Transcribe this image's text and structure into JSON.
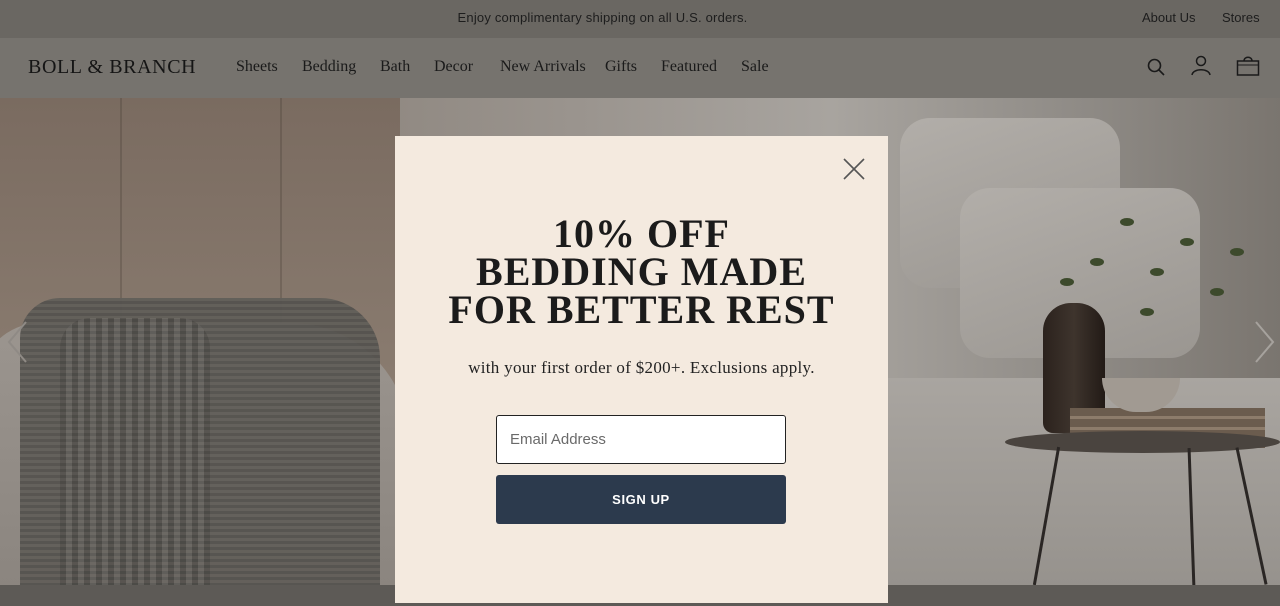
{
  "announcement": {
    "promo_text": "Enjoy complimentary shipping on all U.S. orders.",
    "links": {
      "about": "About Us",
      "stores": "Stores"
    }
  },
  "header": {
    "logo": "BOLL & BRANCH",
    "nav": [
      "Sheets",
      "Bedding",
      "Bath",
      "Decor",
      "New Arrivals",
      "Gifts",
      "Featured",
      "Sale"
    ],
    "icons": [
      "search-icon",
      "account-icon",
      "bag-icon"
    ]
  },
  "hero": {
    "arrows": [
      "chevron-left-icon",
      "chevron-right-icon"
    ]
  },
  "modal": {
    "headline": [
      "10% OFF",
      "BEDDING MADE",
      "FOR BETTER REST"
    ],
    "subtext": "with your first order of $200+. Exclusions apply.",
    "email_placeholder": "Email Address",
    "email_value": "",
    "submit_label": "SIGN UP",
    "close_icon": "close-icon"
  },
  "colors": {
    "overlay_dim": "#5a5550",
    "modal_bg": "#f4eadf",
    "button_bg": "#2c3a4d",
    "button_text": "#ffffff"
  }
}
